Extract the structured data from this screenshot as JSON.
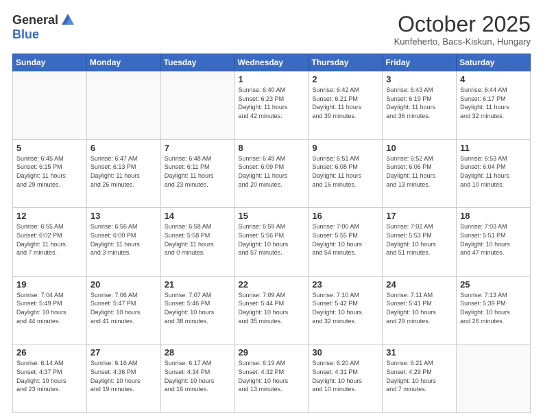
{
  "header": {
    "logo_general": "General",
    "logo_blue": "Blue",
    "month_title": "October 2025",
    "location": "Kunfeherto, Bacs-Kiskun, Hungary"
  },
  "days_of_week": [
    "Sunday",
    "Monday",
    "Tuesday",
    "Wednesday",
    "Thursday",
    "Friday",
    "Saturday"
  ],
  "weeks": [
    [
      {
        "day": "",
        "info": ""
      },
      {
        "day": "",
        "info": ""
      },
      {
        "day": "",
        "info": ""
      },
      {
        "day": "1",
        "info": "Sunrise: 6:40 AM\nSunset: 6:23 PM\nDaylight: 11 hours\nand 42 minutes."
      },
      {
        "day": "2",
        "info": "Sunrise: 6:42 AM\nSunset: 6:21 PM\nDaylight: 11 hours\nand 39 minutes."
      },
      {
        "day": "3",
        "info": "Sunrise: 6:43 AM\nSunset: 6:19 PM\nDaylight: 11 hours\nand 36 minutes."
      },
      {
        "day": "4",
        "info": "Sunrise: 6:44 AM\nSunset: 6:17 PM\nDaylight: 11 hours\nand 32 minutes."
      }
    ],
    [
      {
        "day": "5",
        "info": "Sunrise: 6:45 AM\nSunset: 6:15 PM\nDaylight: 11 hours\nand 29 minutes."
      },
      {
        "day": "6",
        "info": "Sunrise: 6:47 AM\nSunset: 6:13 PM\nDaylight: 11 hours\nand 26 minutes."
      },
      {
        "day": "7",
        "info": "Sunrise: 6:48 AM\nSunset: 6:11 PM\nDaylight: 11 hours\nand 23 minutes."
      },
      {
        "day": "8",
        "info": "Sunrise: 6:49 AM\nSunset: 6:09 PM\nDaylight: 11 hours\nand 20 minutes."
      },
      {
        "day": "9",
        "info": "Sunrise: 6:51 AM\nSunset: 6:08 PM\nDaylight: 11 hours\nand 16 minutes."
      },
      {
        "day": "10",
        "info": "Sunrise: 6:52 AM\nSunset: 6:06 PM\nDaylight: 11 hours\nand 13 minutes."
      },
      {
        "day": "11",
        "info": "Sunrise: 6:53 AM\nSunset: 6:04 PM\nDaylight: 11 hours\nand 10 minutes."
      }
    ],
    [
      {
        "day": "12",
        "info": "Sunrise: 6:55 AM\nSunset: 6:02 PM\nDaylight: 11 hours\nand 7 minutes."
      },
      {
        "day": "13",
        "info": "Sunrise: 6:56 AM\nSunset: 6:00 PM\nDaylight: 11 hours\nand 3 minutes."
      },
      {
        "day": "14",
        "info": "Sunrise: 6:58 AM\nSunset: 5:58 PM\nDaylight: 11 hours\nand 0 minutes."
      },
      {
        "day": "15",
        "info": "Sunrise: 6:59 AM\nSunset: 5:56 PM\nDaylight: 10 hours\nand 57 minutes."
      },
      {
        "day": "16",
        "info": "Sunrise: 7:00 AM\nSunset: 5:55 PM\nDaylight: 10 hours\nand 54 minutes."
      },
      {
        "day": "17",
        "info": "Sunrise: 7:02 AM\nSunset: 5:53 PM\nDaylight: 10 hours\nand 51 minutes."
      },
      {
        "day": "18",
        "info": "Sunrise: 7:03 AM\nSunset: 5:51 PM\nDaylight: 10 hours\nand 47 minutes."
      }
    ],
    [
      {
        "day": "19",
        "info": "Sunrise: 7:04 AM\nSunset: 5:49 PM\nDaylight: 10 hours\nand 44 minutes."
      },
      {
        "day": "20",
        "info": "Sunrise: 7:06 AM\nSunset: 5:47 PM\nDaylight: 10 hours\nand 41 minutes."
      },
      {
        "day": "21",
        "info": "Sunrise: 7:07 AM\nSunset: 5:46 PM\nDaylight: 10 hours\nand 38 minutes."
      },
      {
        "day": "22",
        "info": "Sunrise: 7:09 AM\nSunset: 5:44 PM\nDaylight: 10 hours\nand 35 minutes."
      },
      {
        "day": "23",
        "info": "Sunrise: 7:10 AM\nSunset: 5:42 PM\nDaylight: 10 hours\nand 32 minutes."
      },
      {
        "day": "24",
        "info": "Sunrise: 7:11 AM\nSunset: 5:41 PM\nDaylight: 10 hours\nand 29 minutes."
      },
      {
        "day": "25",
        "info": "Sunrise: 7:13 AM\nSunset: 5:39 PM\nDaylight: 10 hours\nand 26 minutes."
      }
    ],
    [
      {
        "day": "26",
        "info": "Sunrise: 6:14 AM\nSunset: 4:37 PM\nDaylight: 10 hours\nand 23 minutes."
      },
      {
        "day": "27",
        "info": "Sunrise: 6:16 AM\nSunset: 4:36 PM\nDaylight: 10 hours\nand 19 minutes."
      },
      {
        "day": "28",
        "info": "Sunrise: 6:17 AM\nSunset: 4:34 PM\nDaylight: 10 hours\nand 16 minutes."
      },
      {
        "day": "29",
        "info": "Sunrise: 6:19 AM\nSunset: 4:32 PM\nDaylight: 10 hours\nand 13 minutes."
      },
      {
        "day": "30",
        "info": "Sunrise: 6:20 AM\nSunset: 4:31 PM\nDaylight: 10 hours\nand 10 minutes."
      },
      {
        "day": "31",
        "info": "Sunrise: 6:21 AM\nSunset: 4:29 PM\nDaylight: 10 hours\nand 7 minutes."
      },
      {
        "day": "",
        "info": ""
      }
    ]
  ]
}
